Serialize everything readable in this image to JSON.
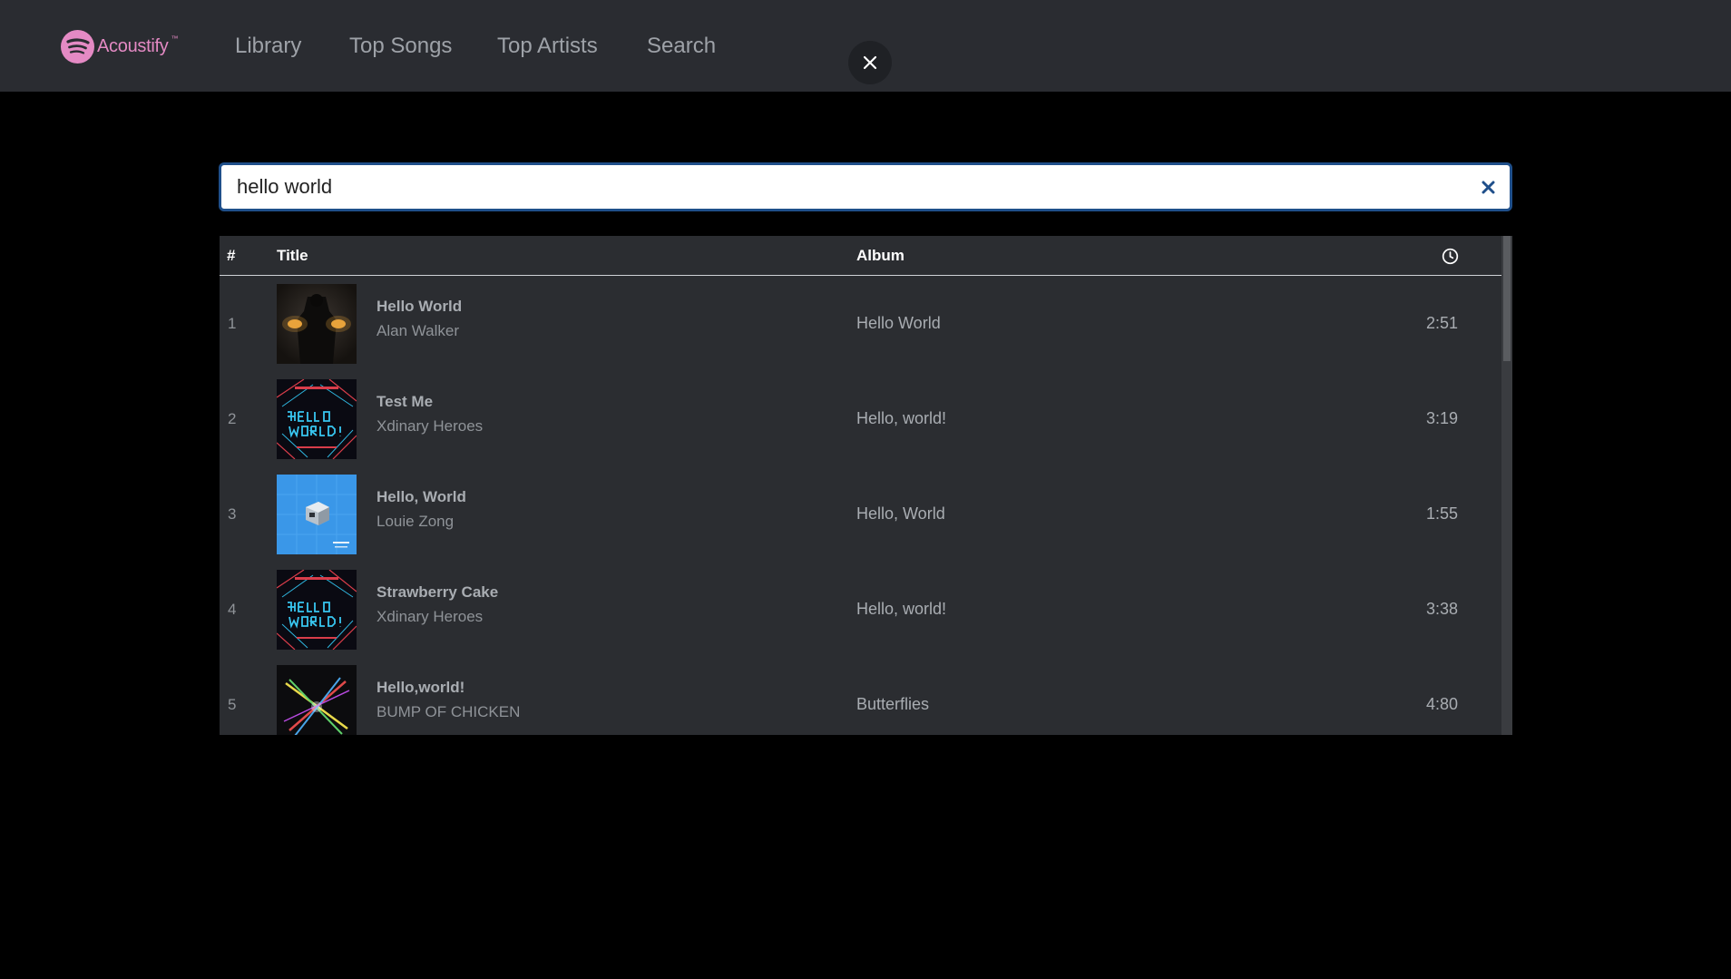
{
  "app": {
    "name": "Acoustify",
    "trademark": "™",
    "brand_color": "#e48ac4"
  },
  "nav": {
    "items": [
      {
        "label": "Library"
      },
      {
        "label": "Top Songs"
      },
      {
        "label": "Top Artists"
      },
      {
        "label": "Search"
      }
    ],
    "close_icon": "close-icon"
  },
  "search": {
    "value": "hello world",
    "placeholder": "",
    "clear_icon": "clear-icon",
    "border_color": "#1f4f8a"
  },
  "table": {
    "headers": {
      "number": "#",
      "title": "Title",
      "album": "Album",
      "duration_icon": "clock-icon"
    },
    "rows": [
      {
        "number": "1",
        "title": "Hello World",
        "artist": "Alan Walker",
        "album": "Hello World",
        "duration": "2:51",
        "cover": "dark-figure-cover"
      },
      {
        "number": "2",
        "title": "Test Me",
        "artist": "Xdinary Heroes",
        "album": "Hello, world!",
        "duration": "3:19",
        "cover": "neon-hello-world-cover"
      },
      {
        "number": "3",
        "title": "Hello, World",
        "artist": "Louie Zong",
        "album": "Hello, World",
        "duration": "1:55",
        "cover": "blue-cube-cover"
      },
      {
        "number": "4",
        "title": "Strawberry Cake",
        "artist": "Xdinary Heroes",
        "album": "Hello, world!",
        "duration": "3:38",
        "cover": "neon-hello-world-cover"
      },
      {
        "number": "5",
        "title": "Hello,world!",
        "artist": "BUMP OF CHICKEN",
        "album": "Butterflies",
        "duration": "4:80",
        "cover": "light-streaks-cover"
      }
    ]
  }
}
